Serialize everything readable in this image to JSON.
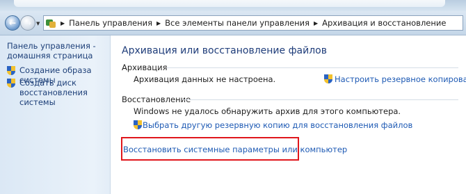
{
  "navigation": {
    "back_label": "←",
    "forward_label": "→",
    "breadcrumbs": [
      "Панель управления",
      "Все элементы панели управления",
      "Архивация и восстановление"
    ]
  },
  "sidebar": {
    "home_link": "Панель управления - домашняя страница",
    "items": [
      {
        "label": "Создание образа системы"
      },
      {
        "label": "Создать диск восстановления системы"
      }
    ]
  },
  "main": {
    "title": "Архивация или восстановление файлов",
    "backup": {
      "heading": "Архивация",
      "status": "Архивация данных не настроена.",
      "setup_link": "Настроить резервное копирование"
    },
    "restore": {
      "heading": "Восстановление",
      "status": "Windows не удалось обнаружить архив для этого компьютера.",
      "select_link": "Выбрать другую резервную копию для восстановления файлов",
      "recover_link": "Восстановить системные параметры или компьютер"
    }
  },
  "colors": {
    "link": "#1e5ab4",
    "title": "#1f3d7a",
    "highlight": "#e0161c"
  }
}
